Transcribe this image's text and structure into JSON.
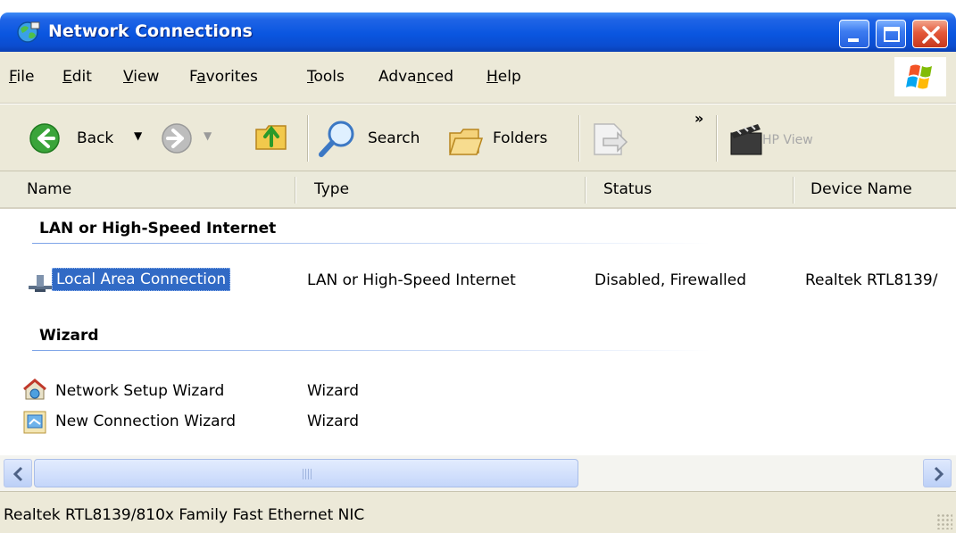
{
  "window": {
    "title": "Network Connections",
    "icon": "network-connections-icon",
    "controls": [
      "minimize-icon",
      "maximize-icon",
      "close-icon"
    ]
  },
  "menu": {
    "file": {
      "accel": "F",
      "rest": "ile"
    },
    "edit": {
      "accel": "E",
      "rest": "dit"
    },
    "view": {
      "accel": "V",
      "rest": "iew"
    },
    "favorites": {
      "pre": "F",
      "accel": "a",
      "rest": "vorites"
    },
    "tools": {
      "accel": "T",
      "rest": "ools"
    },
    "advanced": {
      "pre": "Adva",
      "accel": "n",
      "rest": "ced"
    },
    "help": {
      "accel": "H",
      "rest": "elp"
    }
  },
  "toolbar": {
    "back_label": "Back",
    "search_label": "Search",
    "folders_label": "Folders",
    "overflow": "»",
    "hp_view_label": "HP View"
  },
  "columns": {
    "name": "Name",
    "type": "Type",
    "status": "Status",
    "device": "Device Name"
  },
  "groups": {
    "lan": {
      "title": "LAN or High-Speed Internet",
      "items": [
        {
          "name": "Local Area Connection",
          "type": "LAN or High-Speed Internet",
          "status": "Disabled, Firewalled",
          "device": "Realtek RTL8139/",
          "icon": "lan-connection-icon"
        }
      ]
    },
    "wizard": {
      "title": "Wizard",
      "items": [
        {
          "name": "Network Setup Wizard",
          "type": "Wizard",
          "icon": "network-setup-wizard-icon"
        },
        {
          "name": "New Connection Wizard",
          "type": "Wizard",
          "icon": "new-connection-wizard-icon"
        }
      ]
    }
  },
  "statusbar": {
    "text": "Realtek RTL8139/810x Family Fast Ethernet NIC"
  },
  "colors": {
    "titlebar": "#0a56e0",
    "chrome": "#ece9d8",
    "selection": "#316ac5"
  }
}
